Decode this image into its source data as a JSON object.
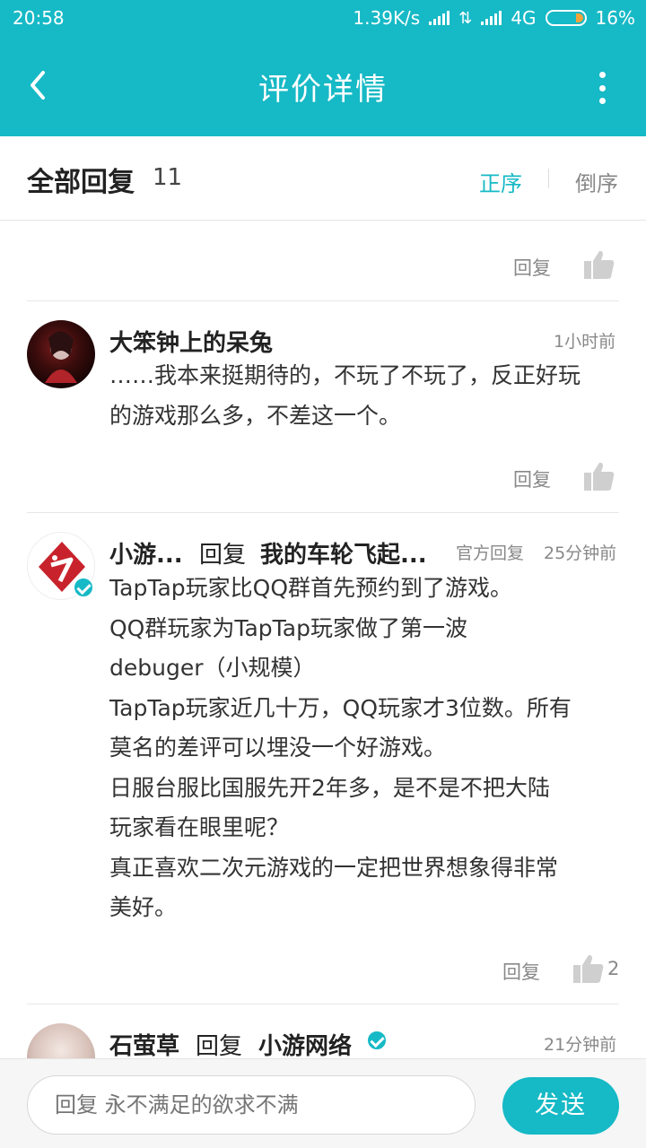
{
  "status_bar": {
    "time": "20:58",
    "speed": "1.39K/s",
    "network": "4G",
    "battery": "16%"
  },
  "header": {
    "title": "评价详情"
  },
  "section": {
    "title": "全部回复",
    "count": "11",
    "sort_asc": "正序",
    "sort_desc": "倒序"
  },
  "top_actions": {
    "reply": "回复"
  },
  "comments": [
    {
      "name": "大笨钟上的呆兔",
      "time": "1小时前",
      "lines": [
        "……我本来挺期待的，不玩了不玩了，反正好玩",
        "的游戏那么多，不差这一个。"
      ],
      "reply_label": "回复"
    },
    {
      "name": "小游...",
      "reply_word": "回复",
      "reply_to": "我的车轮飞起...",
      "official": "官方回复",
      "time": "25分钟前",
      "lines": [
        "TapTap玩家比QQ群首先预约到了游戏。",
        "QQ群玩家为TapTap玩家做了第一波",
        "debuger（小规模）",
        "TapTap玩家近几十万，QQ玩家才3位数。所有",
        "莫名的差评可以埋没一个好游戏。",
        "日服台服比国服先开2年多，是不是不把大陆",
        "玩家看在眼里呢？",
        "真正喜欢二次元游戏的一定把世界想象得非常",
        "美好。"
      ],
      "reply_label": "回复",
      "likes": "2"
    },
    {
      "name": "石萤草",
      "reply_word": "回复",
      "reply_to": "小游网络",
      "time": "21分钟前"
    }
  ],
  "composer": {
    "placeholder": "回复 永不满足的欲求不满",
    "send": "发送"
  },
  "colors": {
    "accent": "#16b9c6"
  }
}
